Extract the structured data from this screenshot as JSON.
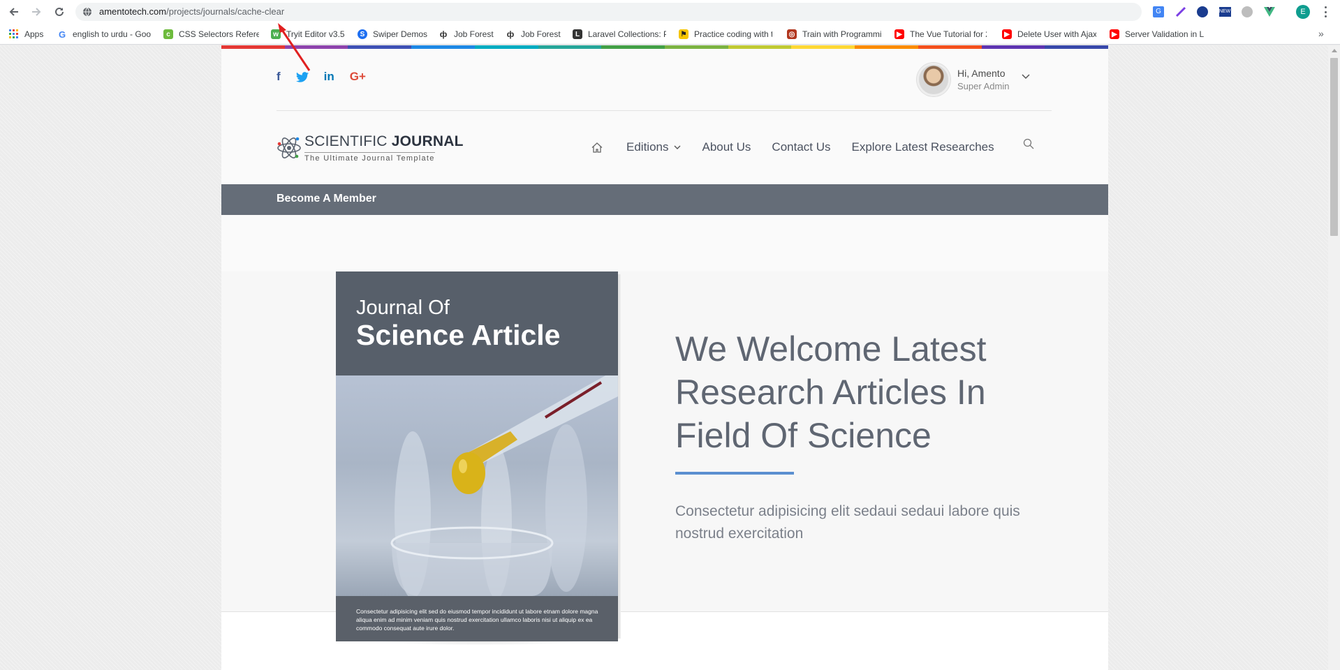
{
  "browser": {
    "url_host": "amentotech.com",
    "url_path": "/projects/journals/cache-clear",
    "profile_initial": "E",
    "bookmarks": [
      {
        "label": "Apps",
        "icon": "apps-grid-icon",
        "color": "#4285f4"
      },
      {
        "label": "english to urdu - Goo",
        "icon": "google-icon",
        "color": "#4285f4"
      },
      {
        "label": "CSS Selectors Refere",
        "icon": "css-icon",
        "color": "#6dbb3c"
      },
      {
        "label": "Tryit Editor v3.5",
        "icon": "w3schools-icon",
        "color": "#4caf50"
      },
      {
        "label": "Swiper Demos",
        "icon": "swiper-icon",
        "color": "#1e6ff1"
      },
      {
        "label": "Job Forest",
        "icon": "jobforest-icon",
        "color": "#333333"
      },
      {
        "label": "Job Forest",
        "icon": "jobforest-icon",
        "color": "#333333"
      },
      {
        "label": "Laravel Collections: P",
        "icon": "laravel-icon",
        "color": "#333333"
      },
      {
        "label": "Practice coding with t",
        "icon": "codewars-icon",
        "color": "#f7c600"
      },
      {
        "label": "Train with Programmi",
        "icon": "codewars-icon",
        "color": "#b1361e"
      },
      {
        "label": "The Vue Tutorial for 2",
        "icon": "youtube-icon",
        "color": "#ff0000"
      },
      {
        "label": "Delete User with Ajax",
        "icon": "youtube-icon",
        "color": "#ff0000"
      },
      {
        "label": "Server Validation in L",
        "icon": "youtube-icon",
        "color": "#ff0000"
      }
    ]
  },
  "site": {
    "rainbow_colors": [
      "#e53935",
      "#8e44ad",
      "#3f51b5",
      "#1e88e5",
      "#00acc1",
      "#26a69a",
      "#43a047",
      "#7cb342",
      "#c0ca33",
      "#fdd835",
      "#fb8c00",
      "#f4511e",
      "#5e35b1",
      "#3949ab"
    ],
    "socials": [
      {
        "name": "facebook-icon",
        "glyph": "f",
        "color": "#3b5998"
      },
      {
        "name": "twitter-icon",
        "glyph": "🐦",
        "color": "#1da1f2"
      },
      {
        "name": "linkedin-icon",
        "glyph": "in",
        "color": "#0077b5"
      },
      {
        "name": "google-plus-icon",
        "glyph": "G+",
        "color": "#dd4b39"
      }
    ],
    "user": {
      "greeting": "Hi, Amento",
      "role": "Super Admin"
    },
    "logo": {
      "line1_light": "SCIENTIFIC ",
      "line1_bold": "JOURNAL",
      "tagline": "The Ultimate Journal Template"
    },
    "nav": {
      "editions": "Editions",
      "about": "About Us",
      "contact": "Contact Us",
      "explore": "Explore Latest Researches"
    },
    "member_bar": "Become A Member",
    "book": {
      "title_small": "Journal Of",
      "title_big": "Science Article",
      "blurb": "Consectetur adipisicing elit sed do eiusmod tempor incididunt ut labore etnam dolore magna aliqua enim ad minim veniam quis nostrud exercitation ullamco laboris nisi ut aliquip ex ea commodo consequat aute irure dolor."
    },
    "hero": {
      "headline": "We Welcome Latest Research Articles In Field Of Science",
      "lead": "Consectetur adipisicing elit sedaui sedaui labore quis nostrud exercitation",
      "accent": "#5b8fd0"
    }
  }
}
